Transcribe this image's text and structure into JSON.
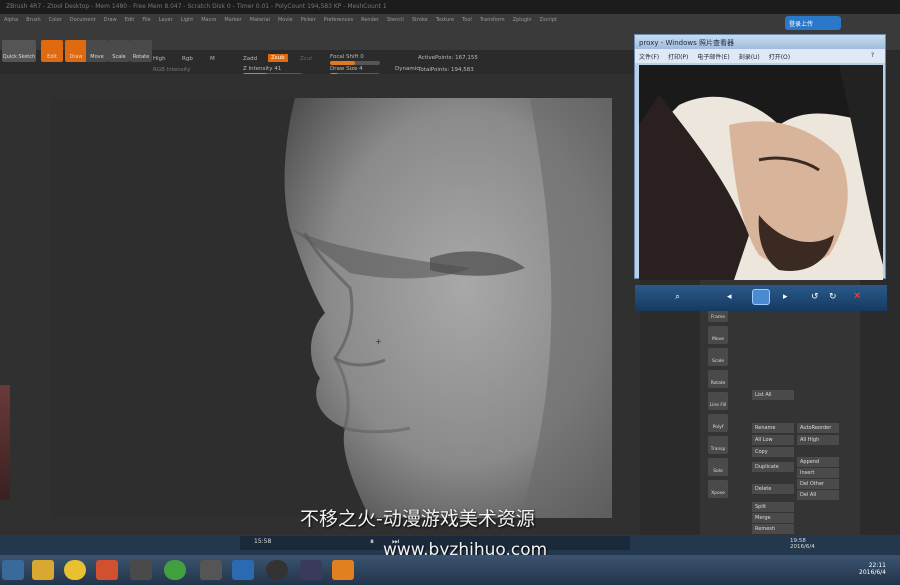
{
  "app": {
    "titlebar_text": "ZBrush 4R7 - Ztool Desktop - Mem 1480 - Free Mem 8.047 - Scratch Disk 0 - Timer 0.01 - PolyCount 194,583 KP - MeshCount 1"
  },
  "menu": {
    "items": [
      "Alpha",
      "Brush",
      "Color",
      "Document",
      "Draw",
      "Edit",
      "File",
      "Layer",
      "Light",
      "Macro",
      "Marker",
      "Material",
      "Movie",
      "Picker",
      "Preferences",
      "Render",
      "Stencil",
      "Stroke",
      "Texture",
      "Tool",
      "Transform",
      "Zplugin",
      "Zscript"
    ]
  },
  "toolbar": {
    "quick_sketch": "Quick Sketch",
    "edit": "Edit",
    "draw": "Draw",
    "move": "Move",
    "scale": "Scale",
    "rotate": "Rotate",
    "high": "High",
    "rgb": "Rgb",
    "m": "M",
    "zadd": "Zadd",
    "zsub": "Zsub",
    "zcut": "Zcut",
    "rgb_intensity": "RGB Intensity",
    "z_intensity": "Z Intensity 41",
    "focal_shift": "Focal Shift 0",
    "draw_size": "Draw Size 4",
    "dynamic": "Dynamic",
    "active_points": "ActivePoints: 167,155",
    "total_points": "TotalPoints: 194,583"
  },
  "viewer": {
    "title": "proxy - Windows 照片查看器",
    "menu": [
      "文件(F)",
      "打印(P)",
      "电子邮件(E)",
      "刻录(U)",
      "打开(O)"
    ],
    "help": "?"
  },
  "login_button": "登录上传",
  "right_panel": {
    "buttons": [
      "List All",
      "Rename",
      "AutoReorder",
      "All Low",
      "All High",
      "Copy",
      "Append",
      "Duplicate",
      "Insert",
      "Del Other",
      "Delete",
      "Del All",
      "Split",
      "Merge",
      "Remesh"
    ],
    "side_icons": [
      "Frame",
      "Move",
      "Scale",
      "Rotate",
      "Line Fill",
      "Polyf",
      "Transp",
      "Solo",
      "Xpose"
    ]
  },
  "watermark": {
    "line1": "不移之火-动漫游戏美术资源",
    "line2": "www.byzhihuo.com"
  },
  "media": {
    "time": "15:58"
  },
  "status_clock": {
    "time": "19:58",
    "date": "2016/6/4"
  },
  "taskbar_clock": {
    "time": "22:11",
    "date": "2016/6/4"
  },
  "colors": {
    "accent": "#e06a10",
    "taskbar": "#22344a"
  }
}
